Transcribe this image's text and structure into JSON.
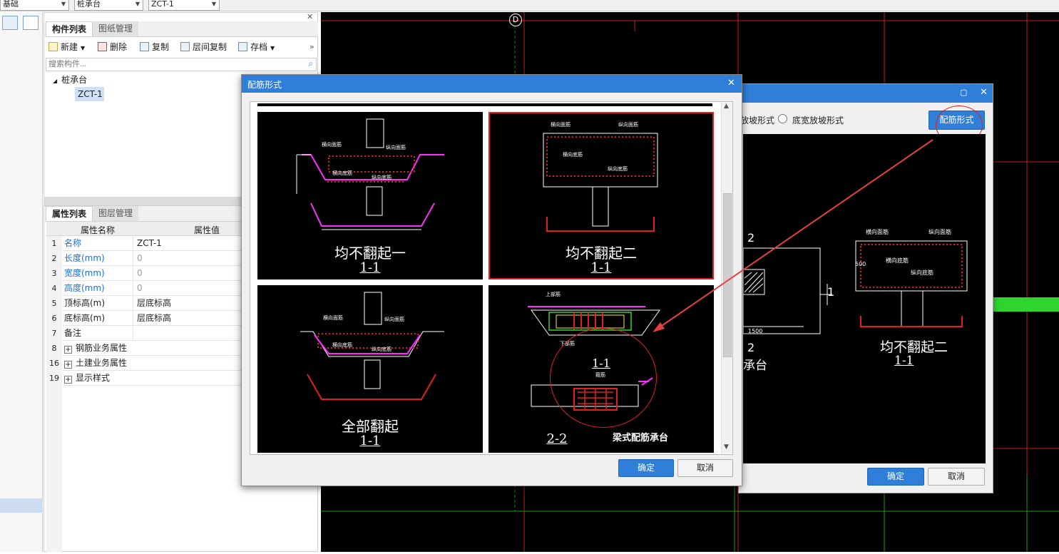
{
  "topbar": {
    "combo1": "基础",
    "combo2": "桩承台",
    "combo3": "ZCT-1"
  },
  "component_panel": {
    "tabs": [
      "构件列表",
      "图纸管理"
    ],
    "toolbar": {
      "new": "新建",
      "delete": "删除",
      "copy": "复制",
      "floor_copy": "层间复制",
      "archive": "存档"
    },
    "search_placeholder": "搜索构件...",
    "tree": {
      "root": "桩承台",
      "child": "ZCT-1"
    }
  },
  "property_panel": {
    "tabs": [
      "属性列表",
      "图层管理"
    ],
    "header": {
      "name": "属性名称",
      "value": "属性值"
    },
    "rows": [
      {
        "n": "1",
        "k": "名称",
        "v": "ZCT-1"
      },
      {
        "n": "2",
        "k": "长度(mm)",
        "v": "0"
      },
      {
        "n": "3",
        "k": "宽度(mm)",
        "v": "0"
      },
      {
        "n": "4",
        "k": "高度(mm)",
        "v": "0"
      },
      {
        "n": "5",
        "k": "顶标高(m)",
        "v": "层底标高"
      },
      {
        "n": "6",
        "k": "底标高(m)",
        "v": "层底标高"
      },
      {
        "n": "7",
        "k": "备注",
        "v": ""
      },
      {
        "n": "8",
        "k": "钢筋业务属性",
        "v": ""
      },
      {
        "n": "16",
        "k": "土建业务属性",
        "v": ""
      },
      {
        "n": "19",
        "k": "显示样式",
        "v": ""
      }
    ]
  },
  "canvas": {
    "axis_label": "D"
  },
  "back_dialog": {
    "radio1": "放坡形式",
    "radio2": "底宽放坡形式",
    "style_button": "配筋形式",
    "preview_caption": "均不翻起二",
    "preview_sub": "1-1",
    "label_2": "2",
    "label_1": "1",
    "label_2b": "2",
    "label_base": "承台",
    "dim_1500": "1500",
    "ok": "确定",
    "cancel": "取消"
  },
  "front_dialog": {
    "title": "配筋形式",
    "options": [
      {
        "caption": "均不翻起一",
        "sub": "1-1"
      },
      {
        "caption": "均不翻起二",
        "sub": "1-1"
      },
      {
        "caption": "全部翻起",
        "sub": "1-1"
      },
      {
        "caption": "梁式配筋承台",
        "sub": "2-2",
        "sub_top": "1-1"
      }
    ],
    "ok": "确定",
    "cancel": "取消"
  },
  "drawing_labels": {
    "top_rebar_x": "横向面筋",
    "top_rebar_y": "纵向面筋",
    "bot_rebar_x": "横向底筋",
    "bot_rebar_y": "纵向底筋",
    "top_bar": "上部筋",
    "bot_bar": "下部筋",
    "hoop": "箍筋"
  },
  "colors": {
    "accent": "#2f7ed8",
    "highlight": "#e01010"
  }
}
